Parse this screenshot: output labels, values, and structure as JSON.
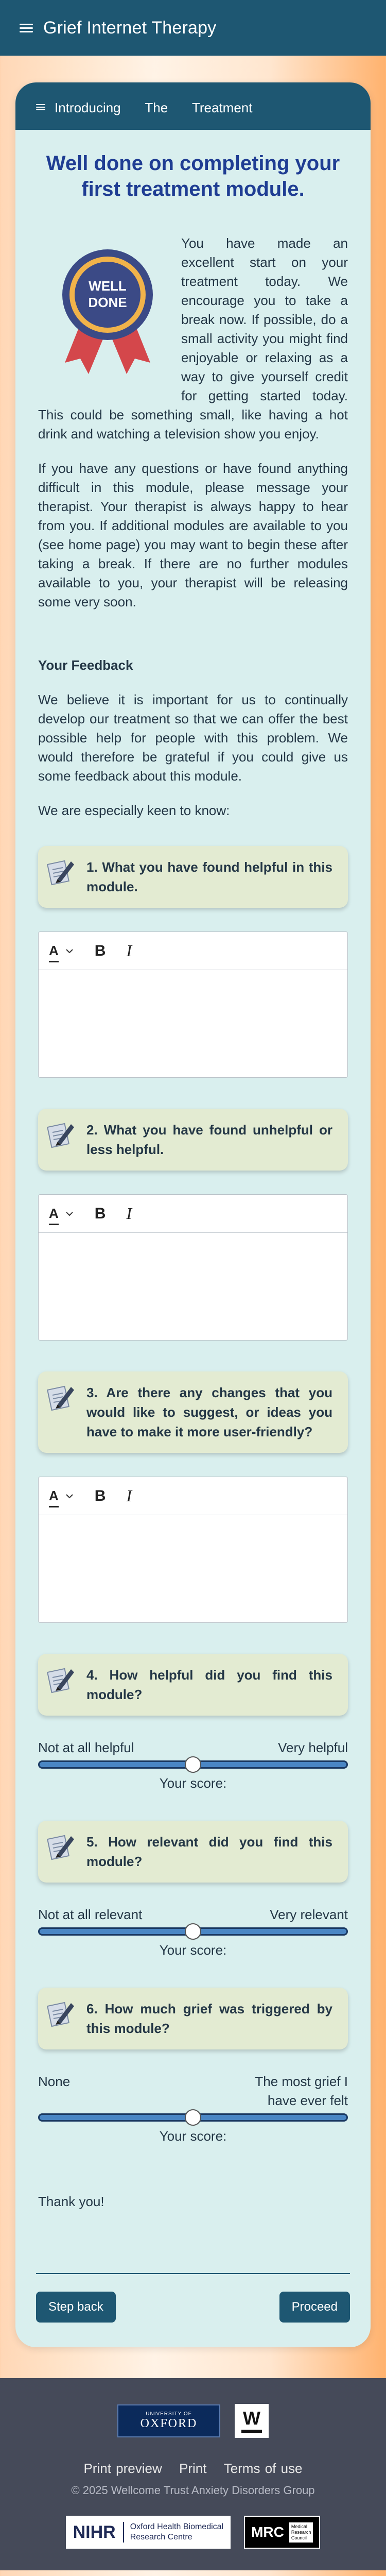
{
  "header": {
    "title": "Grief Internet Therapy"
  },
  "module_bar": {
    "title": "Introducing The Treatment"
  },
  "main": {
    "heading": "Well done on completing your first treatment module.",
    "badge": {
      "line1": "WELL",
      "line2": "DONE"
    },
    "intro_paragraph": "You have made an excellent start on your treatment today. We encourage you to take a break now. If possible, do a small activity you might find enjoyable or relaxing as a way to give yourself credit for getting started today. This could be something small, like having a hot drink and watching a television show you enjoy.",
    "paragraph2": "If you have any questions or have found anything difficult in this module, please message your therapist. Your therapist is always happy to hear from you. If additional modules are available to you (see home page) you may want to begin these after taking a break. If there are no further modules available to you, your therapist will be releasing some very soon.",
    "feedback_heading": "Your Feedback",
    "feedback_intro": "We believe it is important for us to continually develop our treatment so that we can offer the best possible help for people with this problem. We would therefore be grateful if you could give us some feedback about this module.",
    "keen_text": "We are especially keen to know:",
    "questions": [
      {
        "text": "1. What you have found helpful in this module."
      },
      {
        "text": "2. What you have found unhelpful or less helpful."
      },
      {
        "text": "3. Are there any changes that you would like to suggest, or ideas you have to make it more user-friendly?"
      },
      {
        "text": "4.  How helpful did you find this module?"
      },
      {
        "text": "5.  How relevant did you find this module?"
      },
      {
        "text": "6.  How much grief was triggered by this module?"
      }
    ],
    "editor_toolbar": {
      "font": "A",
      "bold": "B",
      "italic": "I"
    },
    "sliders": [
      {
        "left": "Not at all helpful",
        "right": "Very helpful",
        "score_label": "Your score:",
        "value": 0.5
      },
      {
        "left": "Not at all relevant",
        "right": "Very relevant",
        "score_label": "Your score:",
        "value": 0.5
      },
      {
        "left": "None",
        "right": "The most grief I have ever felt",
        "score_label": "Your score:",
        "value": 0.5
      }
    ],
    "thanks": "Thank you!",
    "step_back": "Step back",
    "proceed": "Proceed"
  },
  "footer": {
    "oxford_university": "UNIVERSITY OF",
    "oxford_name": "OXFORD",
    "wellcome_letter": "W",
    "links": [
      "Print preview",
      "Print",
      "Terms of use"
    ],
    "copyright": "© 2025 Wellcome Trust Anxiety Disorders Group",
    "nihr_short": "NIHR",
    "nihr_line1": "Oxford Health Biomedical",
    "nihr_line2": "Research Centre",
    "mrc_short": "MRC",
    "mrc_line1": "Medical",
    "mrc_line2": "Research",
    "mrc_line3": "Council"
  },
  "colors": {
    "header": "#1e5772",
    "card": "#d9efee",
    "heading": "#1f3d93",
    "question_box": "#e3ebd2",
    "slider_track": "#4a86c4",
    "footer": "#454a59"
  }
}
